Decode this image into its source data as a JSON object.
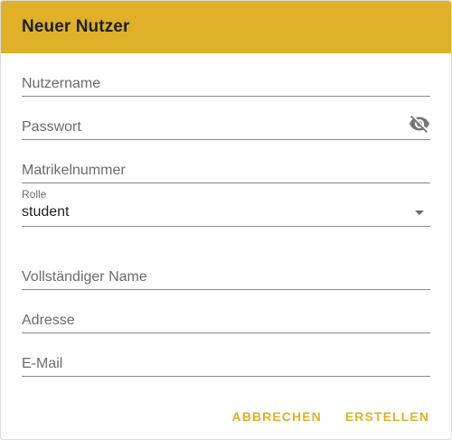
{
  "dialog": {
    "title": "Neuer Nutzer",
    "accent_color": "#e0b028",
    "fields": {
      "username": {
        "placeholder": "Nutzername",
        "value": ""
      },
      "password": {
        "placeholder": "Passwort",
        "value": "",
        "toggle_icon": "visibility-off-icon"
      },
      "matriculation": {
        "placeholder": "Matrikelnummer",
        "value": ""
      },
      "role": {
        "label": "Rolle",
        "value": "student"
      },
      "full_name": {
        "placeholder": "Vollständiger Name",
        "value": ""
      },
      "address": {
        "placeholder": "Adresse",
        "value": ""
      },
      "email": {
        "placeholder": "E-Mail",
        "value": ""
      }
    },
    "actions": {
      "cancel_label": "ABBRECHEN",
      "create_label": "ERSTELLEN"
    }
  }
}
